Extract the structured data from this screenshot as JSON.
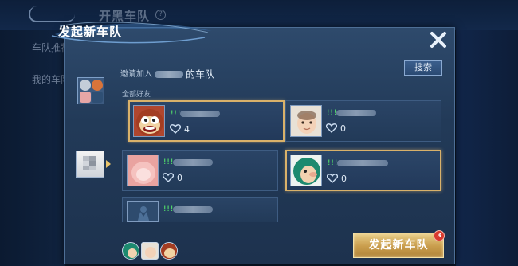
{
  "background": {
    "page_title": "开黑车队",
    "help_symbol": "?",
    "sidebar_items": [
      "车队推荐",
      "我的车队"
    ]
  },
  "modal": {
    "title": "发起新车队",
    "invite_prefix": "邀请加入",
    "invite_suffix": "的车队",
    "search_label": "搜索",
    "section_label": "全部好友",
    "friends": [
      {
        "signal": "!!!",
        "intimacy": "4",
        "selected": true,
        "avatar": "monkey-cartoon-avatar"
      },
      {
        "signal": "!!!",
        "intimacy": "0",
        "selected": false,
        "avatar": "baby-photo-avatar"
      },
      {
        "signal": "!!!",
        "intimacy": "0",
        "selected": false,
        "avatar": "pink-fluffy-avatar"
      },
      {
        "signal": "!!!",
        "intimacy": "0",
        "selected": true,
        "avatar": "green-cartoon-avatar"
      },
      {
        "signal": "!!!",
        "intimacy": "",
        "selected": false,
        "avatar": "default-silhouette-avatar"
      }
    ],
    "launch_button_label": "发起新车队",
    "launch_badge_count": "3",
    "accent_gold": "#d9b16a",
    "signal_green": "#4fd36a"
  }
}
